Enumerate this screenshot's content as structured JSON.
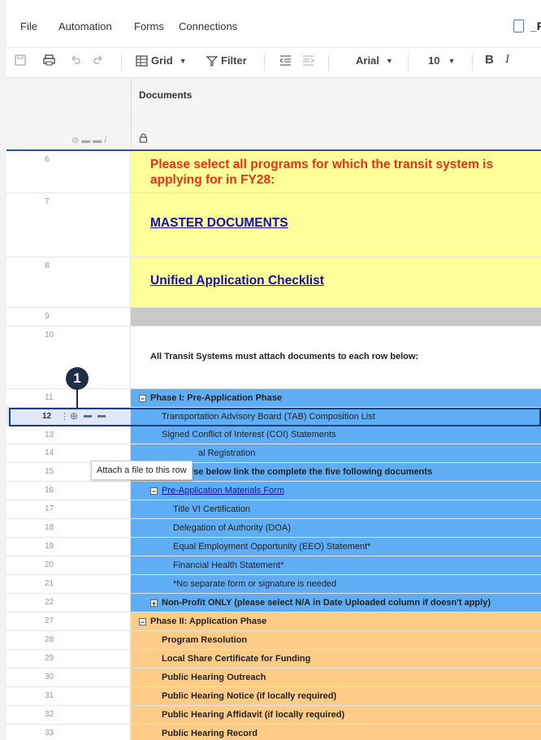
{
  "menu": {
    "file": "File",
    "automation": "Automation",
    "forms": "Forms",
    "connections": "Connections",
    "doc_title": "_F"
  },
  "toolbar": {
    "grid_label": "Grid",
    "filter_label": "Filter",
    "font_name": "Arial",
    "font_size": "10",
    "bold": "B",
    "italic": "I"
  },
  "column": {
    "name": "Documents",
    "lock_icon": "lock-icon"
  },
  "tooltip": "Attach a file to this row",
  "callout": "1",
  "rows": [
    {
      "num": "6",
      "text_line1": "Please select all programs for which the transit system is",
      "text_line2": "applying for in FY28:"
    },
    {
      "num": "7",
      "text": "MASTER DOCUMENTS"
    },
    {
      "num": "8",
      "text": "Unified Application Checklist"
    },
    {
      "num": "9",
      "text": ""
    },
    {
      "num": "10",
      "text": "All Transit Systems must attach documents to each row below:"
    },
    {
      "num": "11",
      "text": "Phase I: Pre-Application Phase"
    },
    {
      "num": "12",
      "text": "Transportation Advisory Board (TAB) Composition List"
    },
    {
      "num": "13",
      "text": "Signed Conflict of Interest (COI) Statements"
    },
    {
      "num": "14",
      "text": "al Registration"
    },
    {
      "num": "15",
      "text": "Note: Use below link the complete the five following documents"
    },
    {
      "num": "16",
      "text": "Pre-Application Materials Form"
    },
    {
      "num": "17",
      "text": "Title VI Certification"
    },
    {
      "num": "18",
      "text": "Delegation of Authority (DOA)"
    },
    {
      "num": "19",
      "text": "Equal Employment Opportunity (EEO) Statement*"
    },
    {
      "num": "20",
      "text": "Financial Health Statement*"
    },
    {
      "num": "21",
      "text": "*No separate form or signature is needed"
    },
    {
      "num": "22",
      "text": "Non-Profit ONLY (please select N/A in Date Uploaded column if doesn't apply)"
    },
    {
      "num": "27",
      "text": "Phase II: Application Phase"
    },
    {
      "num": "28",
      "text": "Program Resolution"
    },
    {
      "num": "29",
      "text": "Local Share Certificate for Funding"
    },
    {
      "num": "30",
      "text": "Public Hearing Outreach"
    },
    {
      "num": "31",
      "text": "Public Hearing Notice (if locally required)"
    },
    {
      "num": "32",
      "text": "Public Hearing Affidavit (if locally required)"
    },
    {
      "num": "33",
      "text": "Public Hearing Record"
    }
  ],
  "colors": {
    "yellow": "#ffff99",
    "blue": "#5faef5",
    "orange": "#ffcc88",
    "red_text": "#e8301c",
    "link": "#1a0dab"
  }
}
